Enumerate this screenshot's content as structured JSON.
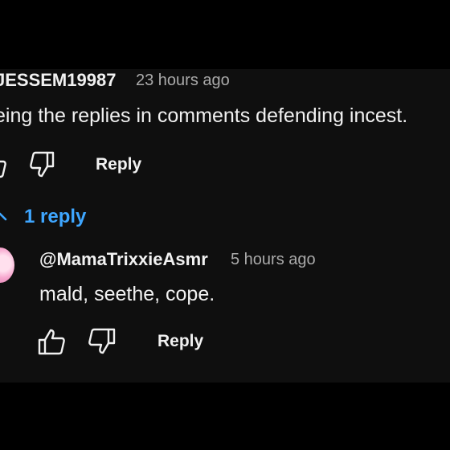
{
  "comment": {
    "author": "JESSEM19987",
    "time": "23 hours ago",
    "text": "eing the replies in comments defending incest.",
    "reply_label": "Reply",
    "icons": {
      "like": "thumbs-up-icon",
      "dislike": "thumbs-down-icon"
    }
  },
  "replies_toggle": {
    "label": "1 reply",
    "icon": "chevron-up-icon",
    "color": "#3ea6ff"
  },
  "reply": {
    "author": "@MamaTrixxieAsmr",
    "time": "5 hours ago",
    "text": "mald, seethe, cope.",
    "reply_label": "Reply",
    "icons": {
      "avatar": "avatar-icon",
      "like": "thumbs-up-icon",
      "dislike": "thumbs-down-icon"
    }
  },
  "colors": {
    "background": "#0f0f0f",
    "letterbox": "#000000",
    "text": "#f1f1f1",
    "secondary": "#aaaaaa",
    "link": "#3ea6ff"
  }
}
